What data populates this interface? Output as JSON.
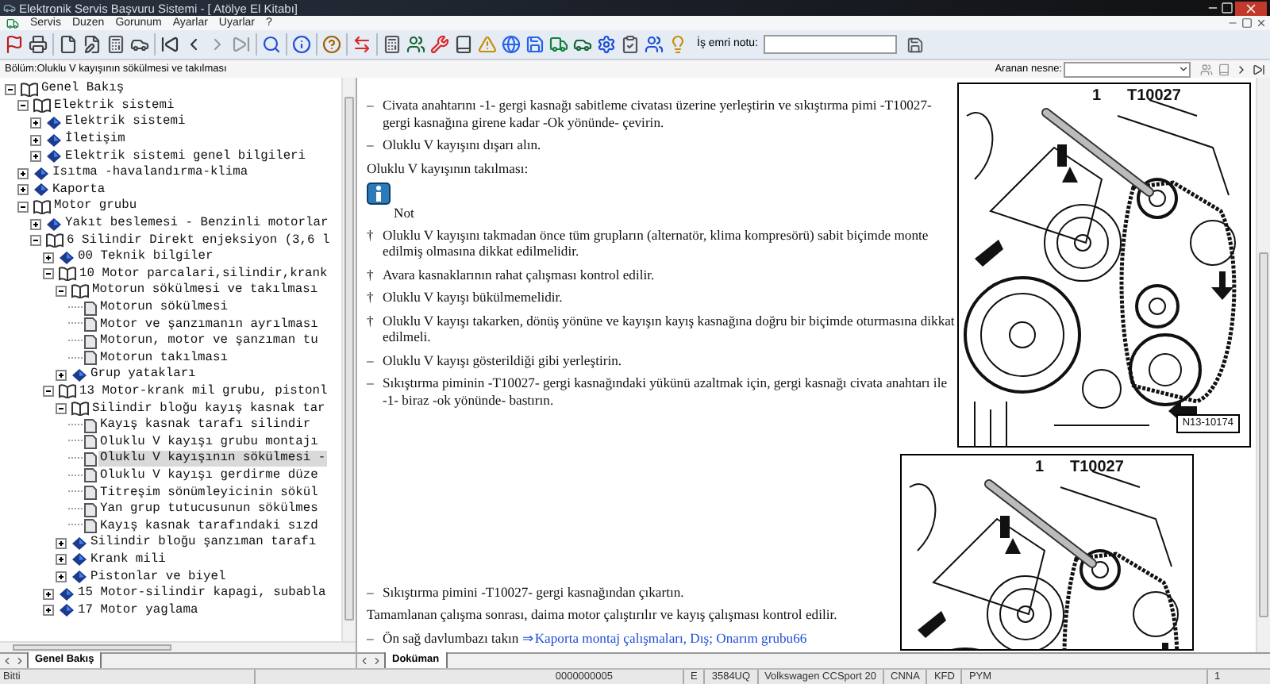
{
  "window": {
    "title": "Elektronik Servis Başvuru Sistemi - [ Atölye El Kitabı]"
  },
  "menu": [
    "Servis",
    "Duzen",
    "Gorunum",
    "Ayarlar",
    "Uyarlar",
    "?"
  ],
  "work_order": {
    "label": "İş emri notu:"
  },
  "breadcrumb": "Bölüm:Oluklu V kayışının sökülmesi ve takılması",
  "search": {
    "label": "Aranan nesne:"
  },
  "tree": [
    {
      "label": "Genel Bakış",
      "kind": "folder",
      "expanded": true,
      "selected": false,
      "children": [
        {
          "label": "Elektrik sistemi",
          "kind": "folder",
          "expanded": true,
          "selected": false,
          "children": [
            {
              "label": "Elektrik sistemi",
              "kind": "folder",
              "expanded": false,
              "selected": false
            },
            {
              "label": "İletişim",
              "kind": "folder",
              "expanded": false,
              "selected": false
            },
            {
              "label": "Elektrik sistemi genel bilgileri",
              "kind": "folder",
              "expanded": false,
              "selected": false
            }
          ]
        },
        {
          "label": "Isıtma -havalandırma-klima",
          "kind": "folder",
          "expanded": false,
          "selected": false
        },
        {
          "label": "Kaporta",
          "kind": "folder",
          "expanded": false,
          "selected": false
        },
        {
          "label": "Motor grubu",
          "kind": "folder",
          "expanded": true,
          "selected": false,
          "children": [
            {
              "label": "Yakıt beslemesi - Benzinli motorlar",
              "kind": "folder",
              "expanded": false,
              "selected": false
            },
            {
              "label": "6 Silindir Direkt enjeksiyon (3,6 l",
              "kind": "folder",
              "expanded": true,
              "selected": false,
              "children": [
                {
                  "label": "00 Teknik bilgiler",
                  "kind": "folder",
                  "expanded": false,
                  "selected": false
                },
                {
                  "label": "10 Motor parcalari,silindir,krank",
                  "kind": "folder",
                  "expanded": true,
                  "selected": false,
                  "children": [
                    {
                      "label": "Motorun sökülmesi ve takılması",
                      "kind": "folder",
                      "expanded": true,
                      "selected": false,
                      "children": [
                        {
                          "label": "Motorun sökülmesi",
                          "kind": "page",
                          "selected": false
                        },
                        {
                          "label": "Motor ve şanzımanın ayrılması",
                          "kind": "page",
                          "selected": false
                        },
                        {
                          "label": "Motorun, motor ve şanzıman tu",
                          "kind": "page",
                          "selected": false
                        },
                        {
                          "label": "Motorun takılması",
                          "kind": "page",
                          "selected": false
                        }
                      ]
                    },
                    {
                      "label": "Grup yatakları",
                      "kind": "folder",
                      "expanded": false,
                      "selected": false
                    }
                  ]
                },
                {
                  "label": "13 Motor-krank mil grubu, pistonl",
                  "kind": "folder",
                  "expanded": true,
                  "selected": false,
                  "children": [
                    {
                      "label": "Silindir bloğu kayış kasnak tar",
                      "kind": "folder",
                      "expanded": true,
                      "selected": false,
                      "children": [
                        {
                          "label": "Kayış kasnak tarafı silindir",
                          "kind": "page",
                          "selected": false
                        },
                        {
                          "label": "Oluklu V kayışı grubu montajı",
                          "kind": "page",
                          "selected": false
                        },
                        {
                          "label": "Oluklu V kayışının sökülmesi -",
                          "kind": "page",
                          "selected": true
                        },
                        {
                          "label": "Oluklu V kayışı gerdirme düze",
                          "kind": "page",
                          "selected": false
                        },
                        {
                          "label": "Titreşim sönümleyicinin sökül",
                          "kind": "page",
                          "selected": false
                        },
                        {
                          "label": "Yan grup tutucusunun sökülmes",
                          "kind": "page",
                          "selected": false
                        },
                        {
                          "label": "Kayış kasnak tarafındaki sızd",
                          "kind": "page",
                          "selected": false
                        }
                      ]
                    },
                    {
                      "label": "Silindir bloğu şanzıman tarafı",
                      "kind": "folder",
                      "expanded": false,
                      "selected": false
                    },
                    {
                      "label": "Krank mili",
                      "kind": "folder",
                      "expanded": false,
                      "selected": false
                    },
                    {
                      "label": "Pistonlar ve biyel",
                      "kind": "folder",
                      "expanded": false,
                      "selected": false
                    }
                  ]
                },
                {
                  "label": "15 Motor-silindir kapagi, subabla",
                  "kind": "folder",
                  "expanded": false,
                  "selected": false
                },
                {
                  "label": "17 Motor yaglama",
                  "kind": "folder",
                  "expanded": false,
                  "selected": false
                }
              ]
            }
          ]
        }
      ]
    }
  ],
  "left_tab": {
    "label": "Genel Bakış",
    "selected": true
  },
  "document": {
    "blocks_top": [
      {
        "kind": "step",
        "marker": "–",
        "text": "Civata anahtarını -1- gergi kasnağı sabitleme civatası üzerine yerleştirin ve sıkıştırma pimi -T10027- gergi kasnağına girene kadar -Ok yönünde- çevirin."
      },
      {
        "kind": "step",
        "marker": "–",
        "text": "Oluklu V kayışını dışarı alın."
      },
      {
        "kind": "heading",
        "text": "Oluklu V kayışının takılması:"
      },
      {
        "kind": "note",
        "text": "Not"
      },
      {
        "kind": "step",
        "marker": "†",
        "text": "Oluklu V kayışını takmadan önce tüm grupların (alternatör, klima kompresörü) sabit biçimde monte edilmiş olmasına dikkat edilmelidir."
      },
      {
        "kind": "step",
        "marker": "†",
        "text": "Avara kasnaklarının rahat çalışması kontrol edilir."
      },
      {
        "kind": "step",
        "marker": "†",
        "text": "Oluklu V kayışı bükülmemelidir."
      },
      {
        "kind": "step",
        "marker": "†",
        "text": "Oluklu V kayışı takarken, dönüş yönüne ve kayışın kayış kasnağına doğru bir biçimde oturmasına dikkat edilmeli."
      },
      {
        "kind": "step",
        "marker": "–",
        "text": "Oluklu V kayışı gösterildiği gibi yerleştirin."
      },
      {
        "kind": "step",
        "marker": "–",
        "text": "Sıkıştırma piminin -T10027- gergi kasnağındaki yükünü azaltmak için, gergi kasnağı civata anahtarı ile -1- biraz -ok yönünde- bastırın."
      }
    ],
    "figure_top": {
      "labels": [
        "1",
        "T10027"
      ],
      "code": "N13-10174"
    },
    "blocks_bottom": [
      {
        "kind": "step",
        "marker": "–",
        "text": "Sıkıştırma pimini -T10027- gergi kasnağından çıkartın."
      },
      {
        "kind": "heading",
        "text": "Tamamlanan çalışma sonrası, daima motor çalıştırılır ve kayış çalışması kontrol edilir."
      },
      {
        "kind": "step",
        "marker": "–",
        "text": "Ön sağ davlumbazı takın",
        "link": "⇒Kaporta montaj çalışmaları, Dış; Onarım grubu66"
      }
    ],
    "figure_bottom": {
      "labels": [
        "1",
        "T10027"
      ]
    }
  },
  "doc_tab": {
    "label": "Doküman",
    "selected": true
  },
  "status_bar": [
    "Bitti",
    "0000000005",
    "E",
    "3584UQ",
    "Volkswagen CCSport 20",
    "CNNA",
    "KFD",
    "PYM",
    "1"
  ]
}
